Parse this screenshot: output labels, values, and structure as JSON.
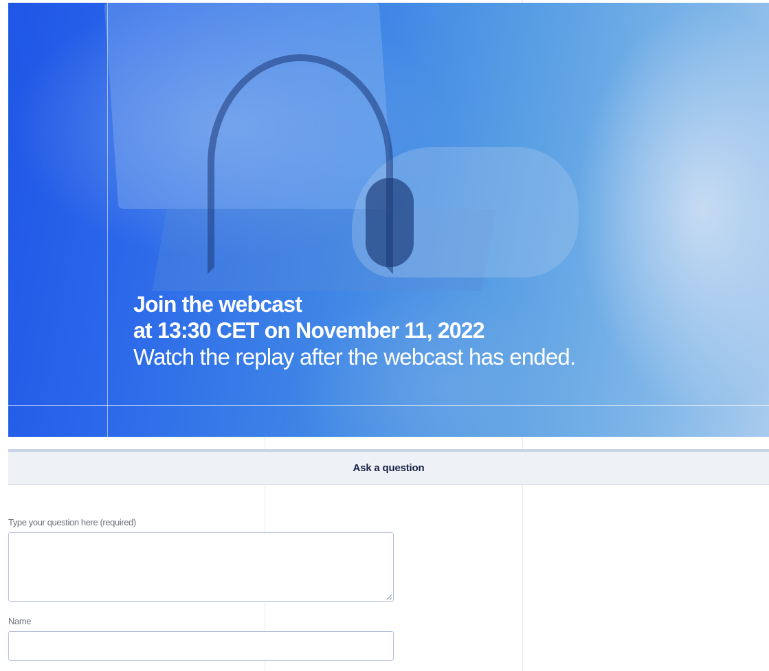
{
  "hero": {
    "line1": "Join the webcast",
    "line2": "at 13:30 CET on November 11, 2022",
    "line3": "Watch the replay after the webcast has ended."
  },
  "qa": {
    "title": "Ask a question",
    "question_label": "Type your question here (required)",
    "question_value": "",
    "name_label": "Name",
    "name_value": ""
  },
  "colors": {
    "hero_blue": "#1f56e6",
    "bar_bg": "#eef1f5",
    "title_text": "#1a2346",
    "input_border": "#b7bfe0"
  },
  "icons": {
    "resize_grip": "resize-grip-icon"
  }
}
